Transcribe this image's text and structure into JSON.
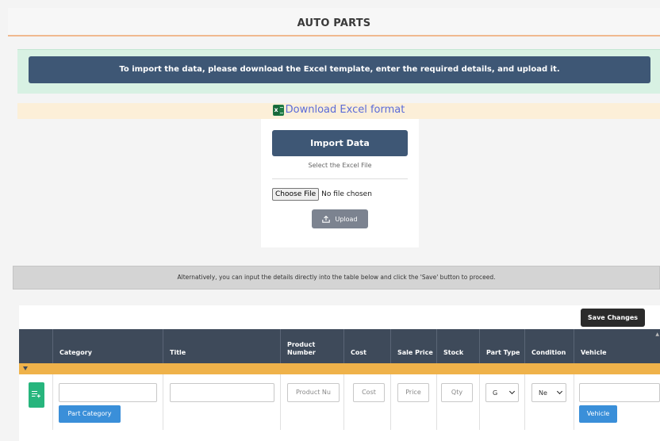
{
  "page_title": "AUTO PARTS",
  "info_message": "To import the data, please download the Excel template, enter the required details, and upload it.",
  "download_link": "Download Excel format",
  "import": {
    "title": "Import Data",
    "select_label": "Select the Excel File",
    "choose_file_button": "Choose File",
    "file_status": "No file chosen",
    "upload_button": "Upload"
  },
  "alternative_message": "Alternatively, you can input the details directly into the table below and click the 'Save' button to proceed.",
  "table": {
    "save_button": "Save Changes",
    "columns": [
      "Category",
      "Title",
      "Product Number",
      "Cost",
      "Sale Price",
      "Stock",
      "Part Type",
      "Condition",
      "Vehicle"
    ],
    "row": {
      "product_number_placeholder": "Product Nu",
      "cost_placeholder": "Cost",
      "price_placeholder": "Price",
      "qty_placeholder": "Qty",
      "part_type_value": "G",
      "condition_value": "Ne",
      "part_category_button": "Part Category",
      "vehicle_button": "Vehicle"
    }
  },
  "colors": {
    "header_blue": "#3e5775",
    "table_header": "#3e4a5a",
    "group_row": "#efb24a",
    "row_add_button": "#27b57d",
    "action_blue": "#3a8fd9",
    "download_link": "#5b6cd8"
  }
}
